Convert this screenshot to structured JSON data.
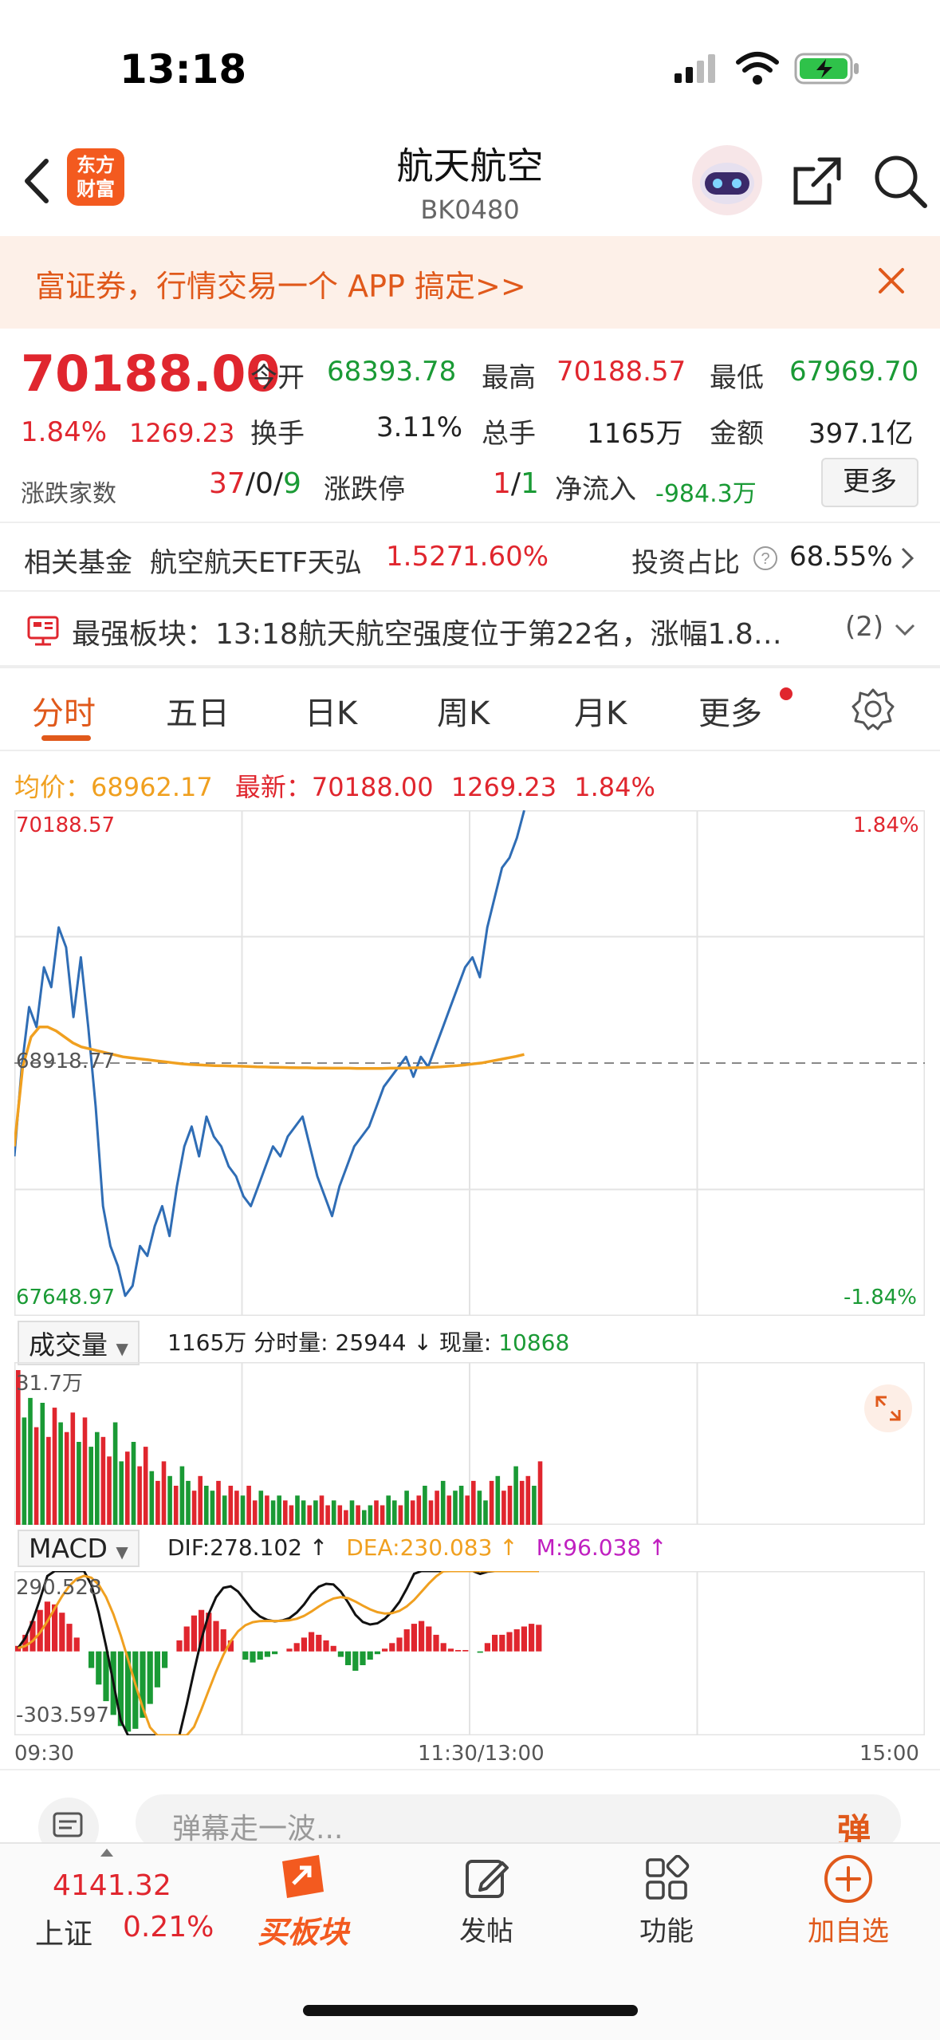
{
  "status_bar": {
    "time": "13:18"
  },
  "header": {
    "logo_text_1": "东方",
    "logo_text_2": "财富",
    "title": "航天航空",
    "code": "BK0480"
  },
  "banner": {
    "text": "富证券，行情交易一个 APP 搞定>>"
  },
  "quote": {
    "price": "70188.00",
    "change_pct": "1.84%",
    "change_abs": "1269.23",
    "open_label": "今开",
    "open_value": "68393.78",
    "high_label": "最高",
    "high_value": "70188.57",
    "low_label": "最低",
    "low_value": "67969.70",
    "turnover_label": "换手",
    "turnover_value": "3.11%",
    "volume_label": "总手",
    "volume_value": "1165万",
    "amount_label": "金额",
    "amount_value": "397.1亿",
    "breadth_label": "涨跌家数",
    "breadth_up": "37",
    "breadth_sep1": "/",
    "breadth_flat": "0",
    "breadth_sep2": "/",
    "breadth_down": "9",
    "limit_label": "涨跌停",
    "limit_up": "1",
    "limit_sep": "/",
    "limit_down": "1",
    "inflow_label": "净流入",
    "inflow_value": "-984.3万",
    "more_button": "更多"
  },
  "fund": {
    "label": "相关基金",
    "name": "航空航天ETF天弘",
    "price": "1.527",
    "pct": "1.60%",
    "ratio_label": "投资占比",
    "ratio_value": "68.55%"
  },
  "strongest": {
    "text": "最强板块：13:18航天航空强度位于第22名，涨幅1.8…",
    "count": "(2)"
  },
  "tabs": [
    "分时",
    "五日",
    "日K",
    "周K",
    "月K",
    "更多"
  ],
  "chart_header": {
    "avg_label": "均价：",
    "avg_value": "68962.17",
    "latest_label": "最新：",
    "latest_value": "70188.00",
    "latest_change": "1269.23",
    "latest_pct": "1.84%"
  },
  "volume_header": {
    "dropdown": "成交量",
    "total": "1165万",
    "minute_label": "分时量:",
    "minute_value": "25944",
    "arrow": "↓",
    "current_label": "现量:",
    "current_value": "10868"
  },
  "macd_header": {
    "dropdown": "MACD",
    "dif": "DIF:278.102 ↑",
    "dea": "DEA:230.083 ↑",
    "m": "M:96.038 ↑"
  },
  "chart_data": [
    {
      "type": "line",
      "title": "分时",
      "ylim": [
        67648.97,
        70188.57
      ],
      "y_ticks": [
        "70188.57",
        "68918.77",
        "67648.97"
      ],
      "right_ticks": [
        "1.84%",
        "-1.84%"
      ],
      "x_ticks": [
        "09:30",
        "11:30/13:00",
        "15:00"
      ],
      "series": [
        {
          "name": "最新",
          "color": "#2f6db5",
          "values": [
            68450,
            68900,
            69200,
            69100,
            69400,
            69300,
            69600,
            69500,
            69150,
            69450,
            69100,
            68700,
            68200,
            68000,
            67900,
            67750,
            67800,
            68000,
            67950,
            68100,
            68200,
            68050,
            68300,
            68500,
            68600,
            68450,
            68650,
            68550,
            68500,
            68400,
            68350,
            68250,
            68200,
            68300,
            68400,
            68500,
            68450,
            68550,
            68600,
            68650,
            68500,
            68350,
            68250,
            68150,
            68300,
            68400,
            68500,
            68550,
            68600,
            68700,
            68800,
            68850,
            68900,
            68950,
            68850,
            68950,
            68900,
            69000,
            69100,
            69200,
            69300,
            69400,
            69450,
            69350,
            69600,
            69750,
            69900,
            69950,
            70050,
            70188
          ]
        },
        {
          "name": "均价",
          "color": "#f0a020",
          "values": [
            68500,
            68900,
            69050,
            69100,
            69100,
            69080,
            69050,
            69020,
            69000,
            68990,
            68980,
            68970,
            68960,
            68950,
            68945,
            68940,
            68935,
            68930,
            68925,
            68920,
            68915,
            68912,
            68910,
            68908,
            68906,
            68905,
            68904,
            68903,
            68902,
            68900,
            68899,
            68898,
            68897,
            68896,
            68895,
            68895,
            68894,
            68894,
            68893,
            68893,
            68893,
            68892,
            68892,
            68892,
            68892,
            68893,
            68893,
            68894,
            68895,
            68896,
            68898,
            68900,
            68903,
            68906,
            68910,
            68915,
            68920,
            68928,
            68936,
            68944,
            68952,
            68962
          ]
        }
      ]
    },
    {
      "type": "bar",
      "title": "成交量",
      "ylim": [
        0,
        31.7
      ],
      "y_ticks": [
        "31.7万"
      ],
      "values": [
        31.7,
        22,
        26,
        20,
        25,
        18,
        24,
        21,
        19,
        23,
        17,
        22,
        16,
        19,
        18,
        14,
        21,
        13,
        15,
        17,
        12,
        16,
        11,
        9,
        13,
        10,
        8,
        12,
        9,
        7,
        10,
        8,
        7,
        9,
        6,
        8,
        7,
        6,
        8,
        5,
        7,
        6,
        5,
        6,
        5,
        4,
        6,
        5,
        4,
        5,
        6,
        4,
        5,
        4,
        3,
        5,
        4,
        3,
        4,
        5,
        4,
        6,
        5,
        4,
        7,
        5,
        6,
        8,
        5,
        7,
        9,
        6,
        7,
        8,
        6,
        9,
        7,
        5,
        9,
        10,
        7,
        8,
        12,
        9,
        10,
        8,
        13
      ]
    },
    {
      "type": "bar",
      "title": "MACD",
      "ylim": [
        -303.597,
        290.528
      ],
      "y_ticks": [
        "290.528",
        "-303.597"
      ],
      "series": [
        {
          "name": "DIF",
          "color": "#111111"
        },
        {
          "name": "DEA",
          "color": "#f0a020"
        },
        {
          "name": "M",
          "color": "#c020c0"
        }
      ],
      "values": [
        20,
        60,
        110,
        150,
        180,
        170,
        140,
        100,
        50,
        0,
        -60,
        -120,
        -180,
        -230,
        -270,
        -290,
        -280,
        -240,
        -190,
        -130,
        -60,
        0,
        40,
        90,
        130,
        150,
        140,
        110,
        80,
        40,
        0,
        -30,
        -40,
        -30,
        -20,
        -10,
        0,
        10,
        30,
        50,
        70,
        60,
        40,
        20,
        -20,
        -50,
        -70,
        -50,
        -30,
        -10,
        10,
        30,
        50,
        80,
        100,
        110,
        90,
        60,
        30,
        10,
        5,
        5,
        0,
        -5,
        30,
        60,
        60,
        70,
        80,
        90,
        100,
        96
      ]
    }
  ],
  "comment_bar": {
    "placeholder": "弹幕走一波...",
    "danmu": "弹"
  },
  "bottom_nav": {
    "index_value": "4141.32",
    "index_name": "上证",
    "index_pct": "0.21%",
    "buy": "买板块",
    "post": "发帖",
    "func": "功能",
    "watch": "加自选"
  }
}
